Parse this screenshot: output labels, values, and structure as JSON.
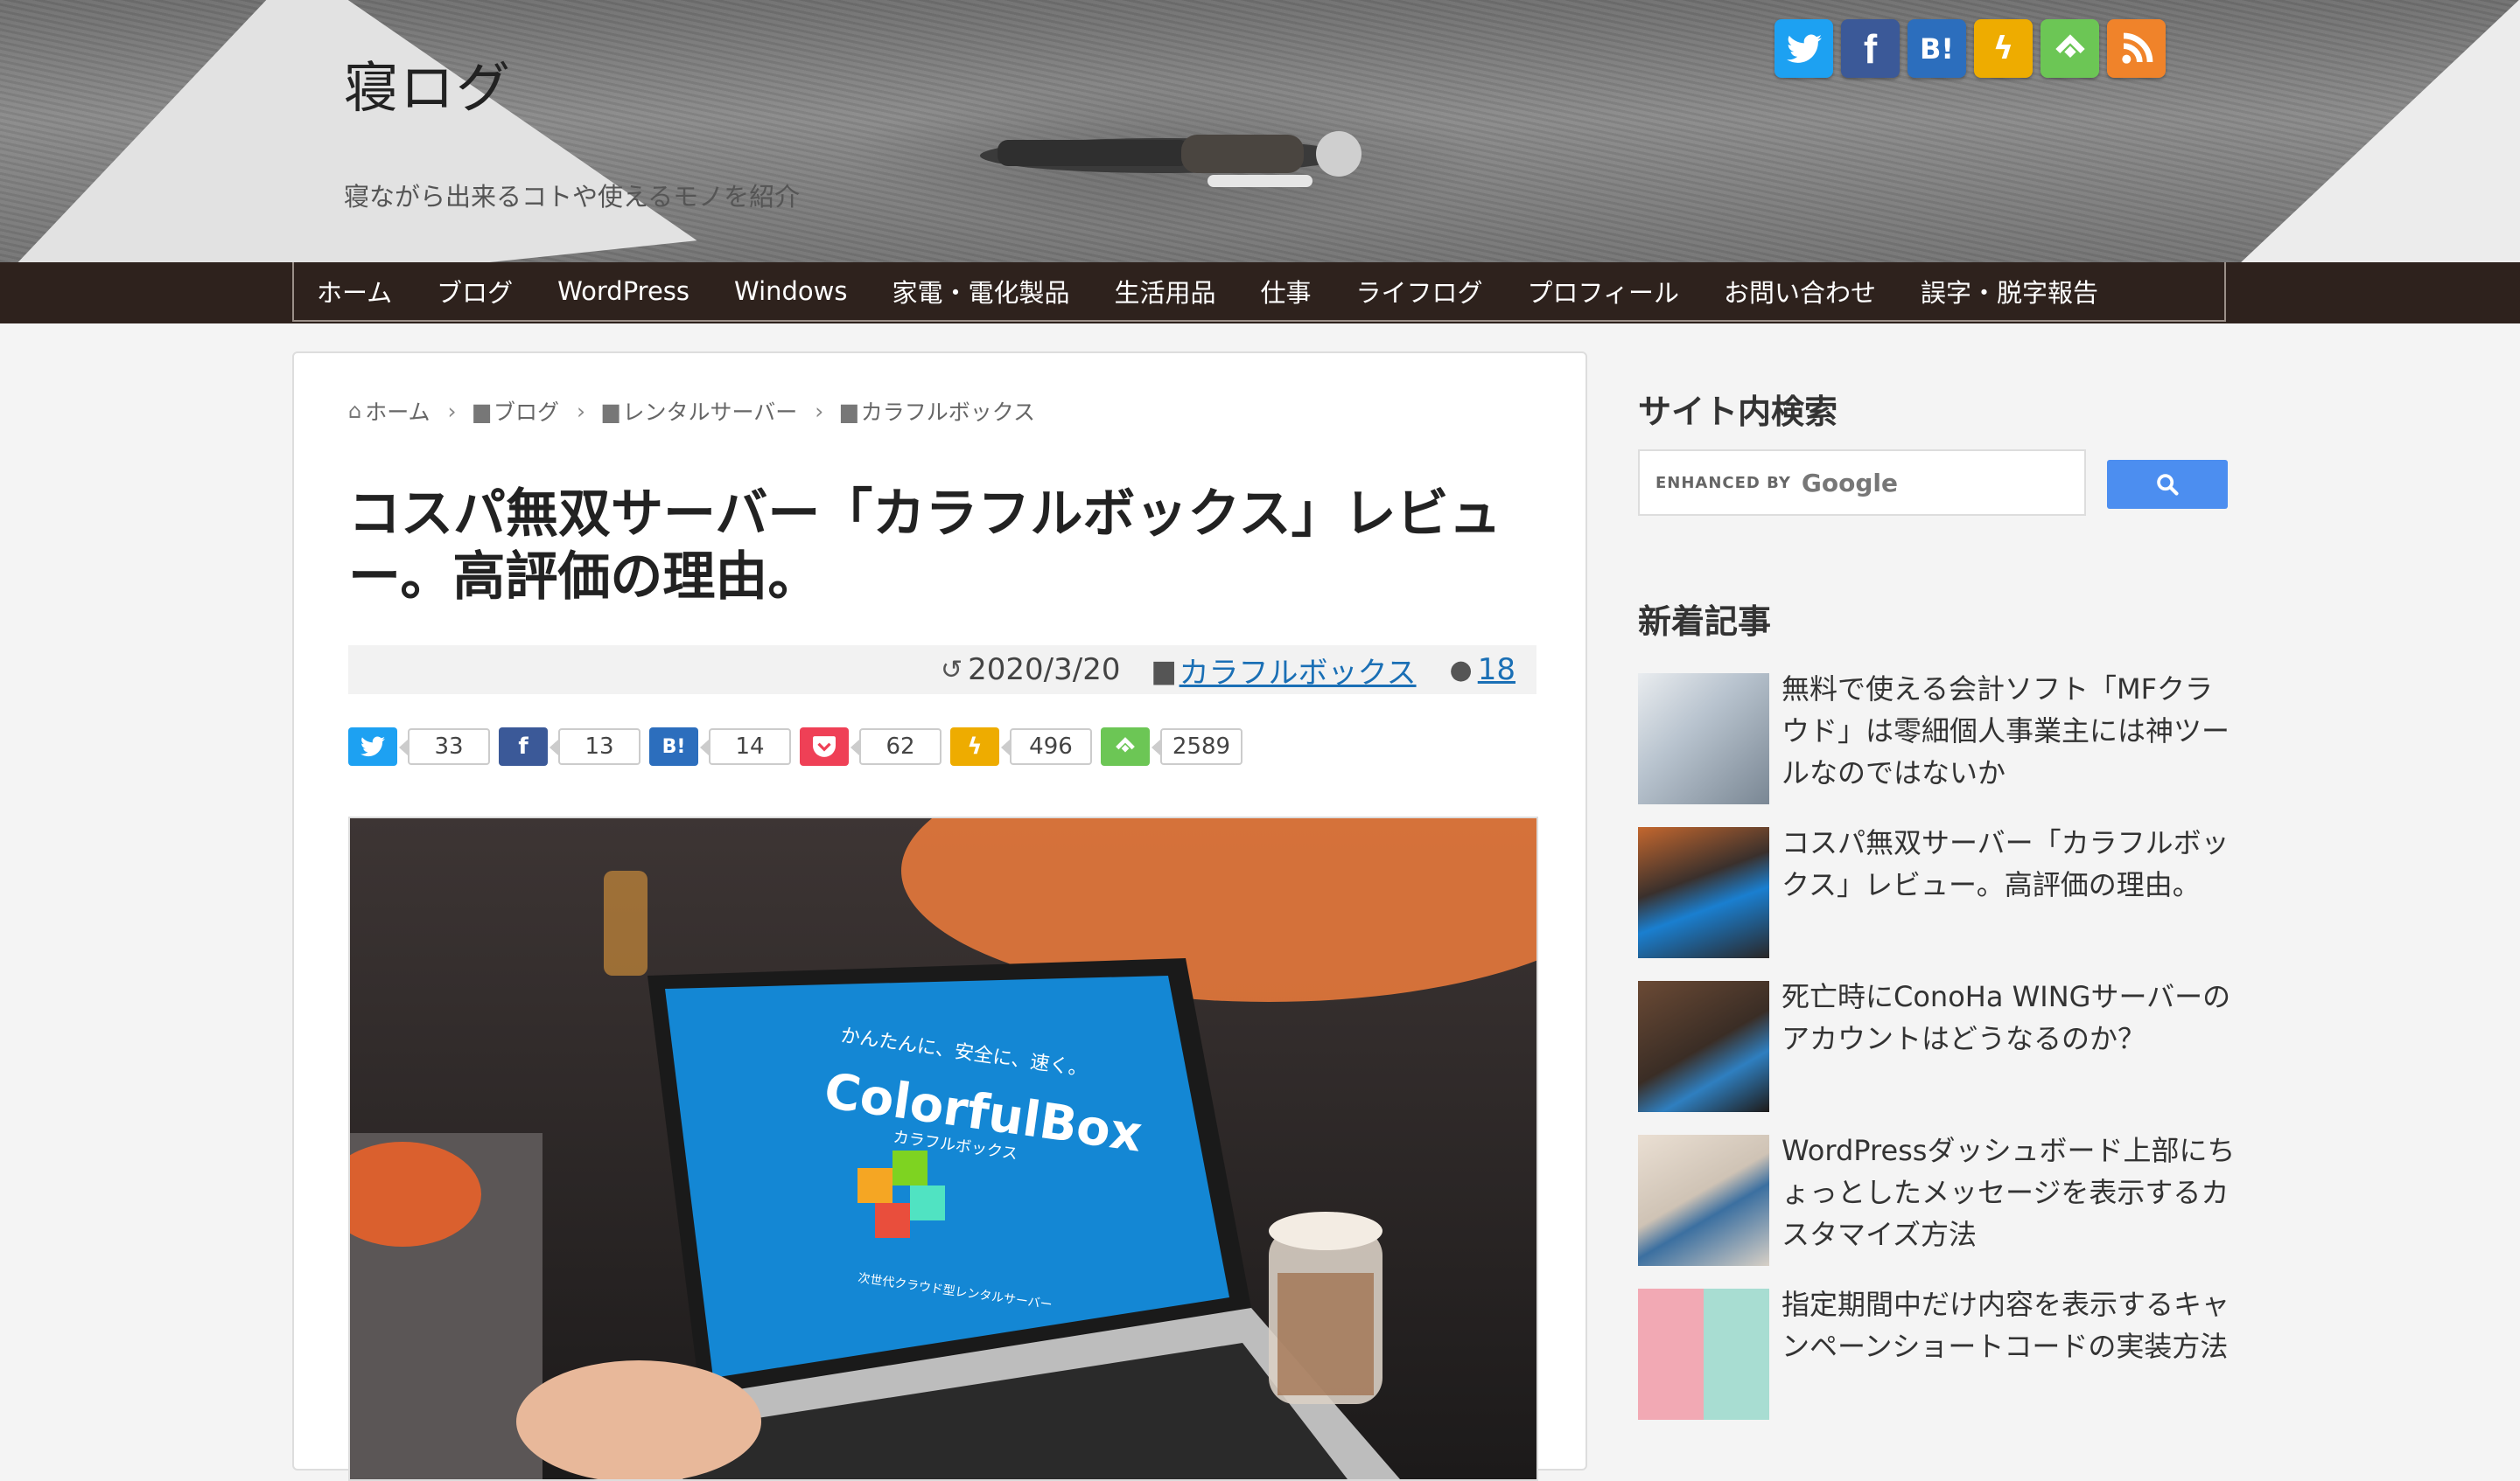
{
  "header": {
    "site_title": "寝ログ",
    "tagline": "寝ながら出来るコトや使えるモノを紹介",
    "social": [
      {
        "name": "twitter",
        "label": "",
        "color": "#1da1f2"
      },
      {
        "name": "facebook",
        "label": "f",
        "color": "#3b5998"
      },
      {
        "name": "hatena",
        "label": "B!",
        "color": "#2c6ebd"
      },
      {
        "name": "push7",
        "label": "ϟ",
        "color": "#eeac00"
      },
      {
        "name": "feedly",
        "label": "",
        "color": "#6cc655"
      },
      {
        "name": "rss",
        "label": "",
        "color": "#f0832a"
      }
    ]
  },
  "nav": {
    "items": [
      "ホーム",
      "ブログ",
      "WordPress",
      "Windows",
      "家電・電化製品",
      "生活用品",
      "仕事",
      "ライフログ",
      "プロフィール",
      "お問い合わせ",
      "誤字・脱字報告"
    ]
  },
  "article": {
    "breadcrumb": [
      "ホーム",
      "ブログ",
      "レンタルサーバー",
      "カラフルボックス"
    ],
    "title": "コスパ無双サーバー「カラフルボックス」レビュー。高評価の理由。",
    "date": "2020/3/20",
    "category": "カラフルボックス",
    "comments": "18",
    "shares": [
      {
        "name": "twitter",
        "label": "",
        "count": "33",
        "color": "#1da1f2"
      },
      {
        "name": "facebook",
        "label": "f",
        "count": "13",
        "color": "#3b5998"
      },
      {
        "name": "hatena",
        "label": "B!",
        "count": "14",
        "color": "#2c6ebd"
      },
      {
        "name": "pocket",
        "label": "",
        "count": "62",
        "color": "#ef4056"
      },
      {
        "name": "push7",
        "label": "ϟ",
        "count": "496",
        "color": "#eeac00"
      },
      {
        "name": "feedly",
        "label": "",
        "count": "2589",
        "color": "#6cc655"
      }
    ],
    "image": {
      "screen_tagline": "かんたんに、安全に、速く。",
      "logo_text": "ColorfulBox",
      "logo_sub": "カラフルボックス",
      "screen_footer": "次世代クラウド型レンタルサーバー"
    }
  },
  "sidebar": {
    "search_heading": "サイト内検索",
    "search_enhanced": "ENHANCED BY",
    "search_google": "Google",
    "recent_heading": "新着記事",
    "posts": [
      {
        "title": "無料で使える会計ソフト「MFクラウド」は零細個人事業主には神ツールなのではないか"
      },
      {
        "title": "コスパ無双サーバー「カラフルボックス」レビュー。高評価の理由。"
      },
      {
        "title": "死亡時にConoHa WINGサーバーのアカウントはどうなるのか？"
      },
      {
        "title": "WordPressダッシュボード上部にちょっとしたメッセージを表示するカスタマイズ方法"
      },
      {
        "title": "指定期間中だけ内容を表示するキャンペーンショートコードの実装方法"
      }
    ]
  }
}
